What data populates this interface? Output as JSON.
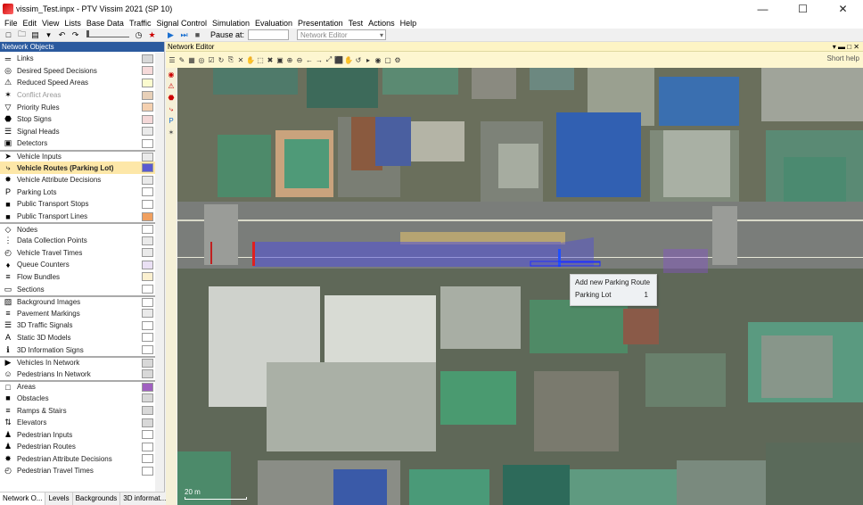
{
  "window": {
    "title": "vissim_Test.inpx - PTV Vissim 2021 (SP 10)",
    "minimize": "—",
    "maximize": "☐",
    "close": "✕"
  },
  "menu": [
    "File",
    "Edit",
    "View",
    "Lists",
    "Base Data",
    "Traffic",
    "Signal Control",
    "Simulation",
    "Evaluation",
    "Presentation",
    "Test",
    "Actions",
    "Help"
  ],
  "toolbar": {
    "pause_label": "Pause at:",
    "pause_value": "",
    "editor_select": "Network Editor"
  },
  "left_panel": {
    "title": "Network Objects",
    "items": [
      {
        "label": "Links",
        "icon": "links-icon",
        "glyph": "═",
        "state": "normal",
        "sep": false,
        "swatch": "#d8d8d8"
      },
      {
        "label": "Desired Speed Decisions",
        "icon": "speed-sign-icon",
        "glyph": "◎",
        "state": "normal",
        "sep": false,
        "swatch": "#f6dada"
      },
      {
        "label": "Reduced Speed Areas",
        "icon": "warning-sign-icon",
        "glyph": "⚠",
        "state": "normal",
        "sep": false,
        "swatch": "#fbfbcf"
      },
      {
        "label": "Conflict Areas",
        "icon": "conflict-icon",
        "glyph": "✶",
        "state": "dim",
        "sep": false,
        "swatch": "#e8d0b8"
      },
      {
        "label": "Priority Rules",
        "icon": "priority-icon",
        "glyph": "▽",
        "state": "normal",
        "sep": false,
        "swatch": "#f4d0b0"
      },
      {
        "label": "Stop Signs",
        "icon": "stop-sign-icon",
        "glyph": "⬣",
        "state": "normal",
        "sep": false,
        "swatch": "#f4d8d8"
      },
      {
        "label": "Signal Heads",
        "icon": "signal-head-icon",
        "glyph": "☰",
        "state": "normal",
        "sep": false,
        "swatch": "#eaeaea"
      },
      {
        "label": "Detectors",
        "icon": "detector-icon",
        "glyph": "▣",
        "state": "normal",
        "sep": false,
        "swatch": "#ffffff"
      },
      {
        "label": "Vehicle Inputs",
        "icon": "vehicle-input-icon",
        "glyph": "➤",
        "state": "normal",
        "sep": true,
        "swatch": "#eaeaea"
      },
      {
        "label": "Vehicle Routes (Parking Lot)",
        "icon": "vehicle-route-icon",
        "glyph": "⤷",
        "state": "selected",
        "sep": false,
        "swatch": "#5a5ad0"
      },
      {
        "label": "Vehicle Attribute Decisions",
        "icon": "attribute-decision-icon",
        "glyph": "✸",
        "state": "normal",
        "sep": false,
        "swatch": "#eaeaea"
      },
      {
        "label": "Parking Lots",
        "icon": "parking-icon",
        "glyph": "P",
        "state": "normal",
        "sep": false,
        "swatch": "#ffffff"
      },
      {
        "label": "Public Transport Stops",
        "icon": "pt-stop-icon",
        "glyph": "■",
        "state": "normal",
        "sep": false,
        "swatch": "#ffffff"
      },
      {
        "label": "Public Transport Lines",
        "icon": "pt-line-icon",
        "glyph": "■",
        "state": "normal",
        "sep": false,
        "swatch": "#f0a060"
      },
      {
        "label": "Nodes",
        "icon": "node-icon",
        "glyph": "◇",
        "state": "normal",
        "sep": true,
        "swatch": "#ffffff"
      },
      {
        "label": "Data Collection Points",
        "icon": "data-collection-icon",
        "glyph": "⋮",
        "state": "normal",
        "sep": false,
        "swatch": "#eaeaea"
      },
      {
        "label": "Vehicle Travel Times",
        "icon": "travel-time-icon",
        "glyph": "◴",
        "state": "normal",
        "sep": false,
        "swatch": "#eaeaea"
      },
      {
        "label": "Queue Counters",
        "icon": "queue-counter-icon",
        "glyph": "♦",
        "state": "normal",
        "sep": false,
        "swatch": "#eae0f4"
      },
      {
        "label": "Flow Bundles",
        "icon": "flow-bundle-icon",
        "glyph": "≡",
        "state": "normal",
        "sep": false,
        "swatch": "#fbf0d0"
      },
      {
        "label": "Sections",
        "icon": "section-icon",
        "glyph": "▭",
        "state": "normal",
        "sep": false,
        "swatch": "#ffffff"
      },
      {
        "label": "Background Images",
        "icon": "background-image-icon",
        "glyph": "▨",
        "state": "normal",
        "sep": true,
        "swatch": "#ffffff"
      },
      {
        "label": "Pavement Markings",
        "icon": "pavement-marking-icon",
        "glyph": "≡",
        "state": "normal",
        "sep": false,
        "swatch": "#eaeaea"
      },
      {
        "label": "3D Traffic Signals",
        "icon": "traffic-signal-3d-icon",
        "glyph": "☰",
        "state": "normal",
        "sep": false,
        "swatch": "#ffffff"
      },
      {
        "label": "Static 3D Models",
        "icon": "static-model-icon",
        "glyph": "A",
        "state": "normal",
        "sep": false,
        "swatch": "#ffffff"
      },
      {
        "label": "3D Information Signs",
        "icon": "info-sign-icon",
        "glyph": "ℹ",
        "state": "normal",
        "sep": false,
        "swatch": "#ffffff"
      },
      {
        "label": "Vehicles In Network",
        "icon": "vehicles-network-icon",
        "glyph": "▶",
        "state": "normal",
        "sep": true,
        "swatch": "#d8d8d8"
      },
      {
        "label": "Pedestrians In Network",
        "icon": "pedestrians-network-icon",
        "glyph": "☺",
        "state": "normal",
        "sep": false,
        "swatch": "#d8d8d8"
      },
      {
        "label": "Areas",
        "icon": "area-icon",
        "glyph": "□",
        "state": "normal",
        "sep": true,
        "swatch": "#a060c0"
      },
      {
        "label": "Obstacles",
        "icon": "obstacle-icon",
        "glyph": "■",
        "state": "normal",
        "sep": false,
        "swatch": "#d8d8d8"
      },
      {
        "label": "Ramps & Stairs",
        "icon": "stairs-icon",
        "glyph": "≡",
        "state": "normal",
        "sep": false,
        "swatch": "#d8d8d8"
      },
      {
        "label": "Elevators",
        "icon": "elevator-icon",
        "glyph": "⇅",
        "state": "normal",
        "sep": false,
        "swatch": "#d8d8d8"
      },
      {
        "label": "Pedestrian Inputs",
        "icon": "pedestrian-input-icon",
        "glyph": "♟",
        "state": "normal",
        "sep": false,
        "swatch": "#ffffff"
      },
      {
        "label": "Pedestrian Routes",
        "icon": "pedestrian-route-icon",
        "glyph": "♟",
        "state": "normal",
        "sep": false,
        "swatch": "#ffffff"
      },
      {
        "label": "Pedestrian Attribute Decisions",
        "icon": "pedestrian-attribute-icon",
        "glyph": "✸",
        "state": "normal",
        "sep": false,
        "swatch": "#ffffff"
      },
      {
        "label": "Pedestrian Travel Times",
        "icon": "pedestrian-travel-icon",
        "glyph": "◴",
        "state": "normal",
        "sep": false,
        "swatch": "#ffffff"
      }
    ],
    "tabs": [
      "Network O...",
      "Levels",
      "Backgrounds",
      "3D informat..."
    ]
  },
  "editor": {
    "title": "Network Editor",
    "short_help": "Short help",
    "tooltip": {
      "title": "Add new Parking Route",
      "key": "Parking Lot",
      "value": "1"
    },
    "scale": "20 m"
  },
  "colors": {
    "route": "#5050d8",
    "start": "#e02020",
    "end": "#2050ff",
    "selection": "#fde7a8"
  }
}
